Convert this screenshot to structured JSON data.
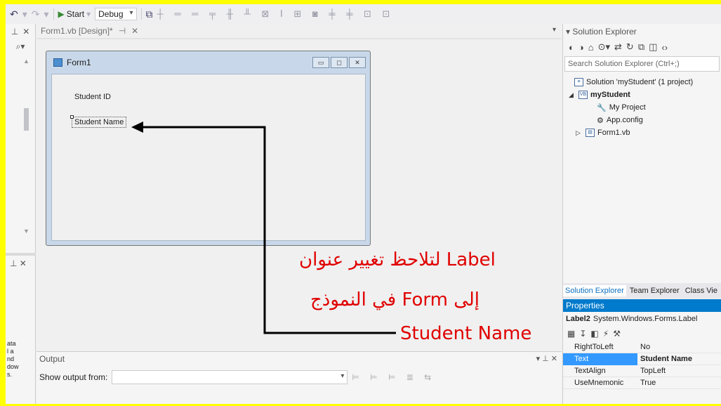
{
  "toolbar": {
    "start_label": "Start",
    "config_value": "Debug"
  },
  "left_panel": {
    "side_text": [
      "ata",
      "l a",
      "nd",
      "dow",
      "s."
    ]
  },
  "tabs": [
    {
      "label": "Form1.vb [Design]*"
    }
  ],
  "form": {
    "title": "Form1",
    "label_id": "Student ID",
    "label_name": "Student Name"
  },
  "annotation": {
    "line1": "لتلاحظ تغيير عنوان    Label",
    "line2": "في النموذج      Form إلى",
    "line3": "Student Name"
  },
  "output": {
    "title": "Output",
    "show_from_label": "Show output from:"
  },
  "solution_explorer": {
    "title": "Solution Explorer",
    "search_placeholder": "Search Solution Explorer (Ctrl+;)",
    "tree": [
      {
        "text": "Solution 'myStudent' (1 project)"
      },
      {
        "text": "myStudent"
      },
      {
        "text": "My Project"
      },
      {
        "text": "App.config"
      },
      {
        "text": "Form1.vb"
      }
    ],
    "tabs": [
      "Solution Explorer",
      "Team Explorer",
      "Class Vie"
    ]
  },
  "properties": {
    "title": "Properties",
    "object_name": "Label2",
    "object_type": "System.Windows.Forms.Label",
    "rows": [
      {
        "name": "RightToLeft",
        "value": "No"
      },
      {
        "name": "Text",
        "value": "Student Name"
      },
      {
        "name": "TextAlign",
        "value": "TopLeft"
      },
      {
        "name": "UseMnemonic",
        "value": "True"
      }
    ]
  },
  "colors": {
    "accent": "#007acc",
    "annotation": "#e00000",
    "border_highlight": "#ffff00"
  }
}
